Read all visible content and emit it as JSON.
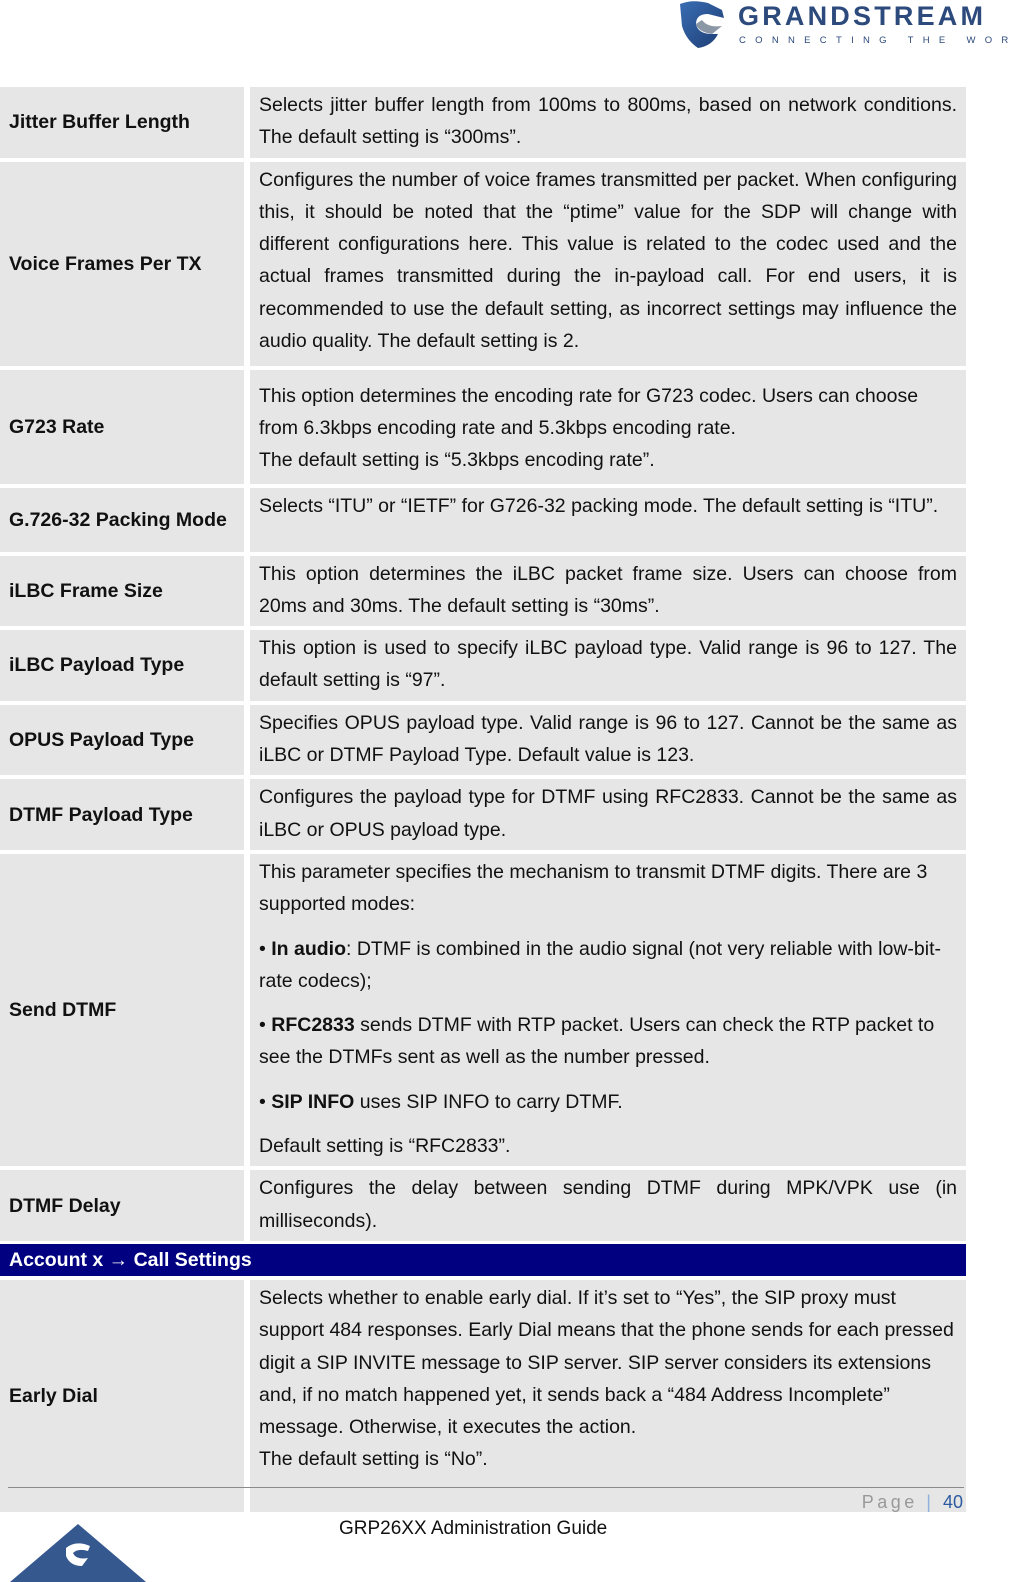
{
  "header": {
    "brand": "GRANDSTREAM",
    "tagline": "CONNECTING THE WORLD",
    "logo_icon": "grandstream-logo-icon"
  },
  "table": {
    "rows": [
      {
        "label": "Jitter Buffer Length",
        "paragraphs": [
          "Selects jitter buffer length from 100ms to 800ms, based on network conditions. The default setting is “300ms”."
        ]
      },
      {
        "label": "Voice Frames Per TX",
        "paragraphs": [
          "Configures the number of voice frames transmitted per packet. When configuring this, it should be noted that the “ptime” value for the SDP will change with different configurations here. This value is related to the codec used and the actual frames transmitted during the in-payload call. For end users, it is recommended to use the default setting, as incorrect settings may influence the audio quality. The default setting is 2."
        ]
      },
      {
        "label": "G723 Rate",
        "paragraphs": [
          "This option determines the encoding rate for G723 codec. Users can choose from 6.3kbps encoding rate and 5.3kbps encoding rate.",
          "The default setting is “5.3kbps encoding rate”."
        ]
      },
      {
        "label": "G.726-32 Packing Mode",
        "paragraphs": [
          "Selects “ITU” or “IETF” for G726-32 packing mode. The default setting is “ITU”."
        ]
      },
      {
        "label": "iLBC Frame Size",
        "paragraphs": [
          "This option determines the iLBC packet frame size. Users can choose from 20ms and 30ms. The default setting is “30ms”."
        ]
      },
      {
        "label": "iLBC Payload Type",
        "paragraphs": [
          "This option is used to specify iLBC payload type. Valid range is 96 to 127. The default setting is “97”."
        ]
      },
      {
        "label": "OPUS Payload Type",
        "paragraphs": [
          "Specifies OPUS payload type. Valid range is 96 to 127. Cannot be the same as iLBC or DTMF Payload Type. Default value is 123."
        ]
      },
      {
        "label": "DTMF Payload Type",
        "paragraphs": [
          "Configures the payload type for DTMF using RFC2833. Cannot be the same as iLBC or OPUS payload type."
        ]
      },
      {
        "label": "Send DTMF",
        "intro": "This parameter specifies the mechanism to transmit DTMF digits. There are 3 supported modes:",
        "bullets": [
          {
            "bold": "In audio",
            "text": ": DTMF is combined in the audio signal (not very reliable with low-bit-rate codecs);"
          },
          {
            "bold": "RFC2833",
            "text": " sends DTMF with RTP packet. Users can check the RTP packet to see the DTMFs sent as well as the number pressed."
          },
          {
            "bold": "SIP INFO",
            "text": " uses SIP INFO to carry DTMF."
          }
        ],
        "bullet_char": "• ",
        "default": "Default setting is “RFC2833”."
      },
      {
        "label": "DTMF Delay",
        "paragraphs": [
          "Configures the delay between sending DTMF during MPK/VPK use (in milliseconds)."
        ]
      }
    ],
    "section": "Account x → Call Settings",
    "section_rows": [
      {
        "label": "Early Dial",
        "paragraphs": [
          "Selects whether to enable early dial. If it’s set to “Yes”, the SIP proxy must support 484 responses. Early Dial means that the phone sends for each pressed digit a SIP INVITE message to SIP server. SIP server considers its extensions and, if no match happened yet, it sends back a “484 Address Incomplete” message. Otherwise, it executes the action.",
          "The default setting is “No”."
        ]
      }
    ]
  },
  "footer": {
    "page_label": "Page",
    "separator": "|",
    "page_number": "40",
    "doc_title": "GRP26XX Administration Guide",
    "logo_icon": "grandstream-triangle-logo-icon"
  },
  "colors": {
    "brand_blue": "#2c4a7c",
    "section_bar": "#000080",
    "cell_bg": "#e6e6e6",
    "page_number": "#2c5aa0"
  }
}
